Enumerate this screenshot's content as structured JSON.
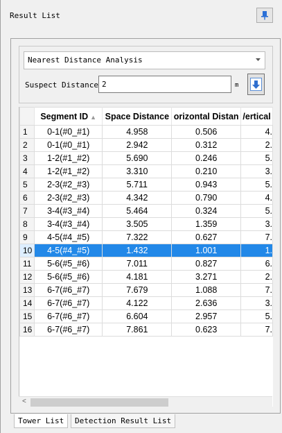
{
  "title": "Result List",
  "analysis": {
    "selected": "Nearest Distance Analysis"
  },
  "suspect": {
    "label": "Suspect Distance:",
    "value": "2",
    "unit": "m"
  },
  "table": {
    "columns": [
      "Segment ID",
      "Space Distance",
      "Horizontal Distance",
      "Vertical Distance"
    ],
    "header_display": [
      "Segment ID",
      "Space Distance",
      "orizontal Distan",
      "/ertical"
    ],
    "selected_row": 10,
    "rows": [
      {
        "n": "1",
        "seg": "0-1(#0_#1)",
        "space": "4.958",
        "horiz": "0.506",
        "vert": "4."
      },
      {
        "n": "2",
        "seg": "0-1(#0_#1)",
        "space": "2.942",
        "horiz": "0.312",
        "vert": "2."
      },
      {
        "n": "3",
        "seg": "1-2(#1_#2)",
        "space": "5.690",
        "horiz": "0.246",
        "vert": "5."
      },
      {
        "n": "4",
        "seg": "1-2(#1_#2)",
        "space": "3.310",
        "horiz": "0.210",
        "vert": "3."
      },
      {
        "n": "5",
        "seg": "2-3(#2_#3)",
        "space": "5.711",
        "horiz": "0.943",
        "vert": "5."
      },
      {
        "n": "6",
        "seg": "2-3(#2_#3)",
        "space": "4.342",
        "horiz": "0.790",
        "vert": "4."
      },
      {
        "n": "7",
        "seg": "3-4(#3_#4)",
        "space": "5.464",
        "horiz": "0.324",
        "vert": "5."
      },
      {
        "n": "8",
        "seg": "3-4(#3_#4)",
        "space": "3.505",
        "horiz": "1.359",
        "vert": "3."
      },
      {
        "n": "9",
        "seg": "4-5(#4_#5)",
        "space": "7.322",
        "horiz": "0.627",
        "vert": "7."
      },
      {
        "n": "10",
        "seg": "4-5(#4_#5)",
        "space": "1.432",
        "horiz": "1.001",
        "vert": "1."
      },
      {
        "n": "11",
        "seg": "5-6(#5_#6)",
        "space": "7.011",
        "horiz": "0.827",
        "vert": "6."
      },
      {
        "n": "12",
        "seg": "5-6(#5_#6)",
        "space": "4.181",
        "horiz": "3.271",
        "vert": "2."
      },
      {
        "n": "13",
        "seg": "6-7(#6_#7)",
        "space": "7.679",
        "horiz": "1.088",
        "vert": "7."
      },
      {
        "n": "14",
        "seg": "6-7(#6_#7)",
        "space": "4.122",
        "horiz": "2.636",
        "vert": "3."
      },
      {
        "n": "15",
        "seg": "6-7(#6_#7)",
        "space": "6.604",
        "horiz": "2.957",
        "vert": "5."
      },
      {
        "n": "16",
        "seg": "6-7(#6_#7)",
        "space": "7.861",
        "horiz": "0.623",
        "vert": "7."
      }
    ]
  },
  "tabs": [
    {
      "label": "Tower List",
      "active": true
    },
    {
      "label": "Detection Result List",
      "active": false
    }
  ],
  "colors": {
    "selection": "#2288e8",
    "pin_icon": "#2a6fd6"
  }
}
